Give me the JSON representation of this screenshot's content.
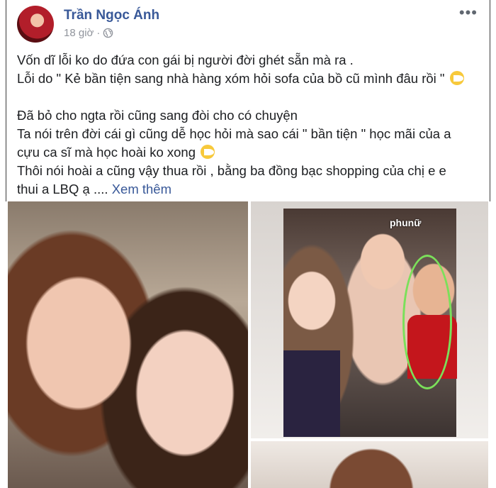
{
  "post": {
    "author": "Trần Ngọc Ánh",
    "time": "18 giờ",
    "privacy_icon": "globe-icon",
    "more_icon": "more-icon",
    "more_label": "•••",
    "lines": [
      "Vốn dĩ lỗi ko do đứa con gái bị người đời ghét sẵn mà ra .",
      "Lỗi do \" Kẻ bần tiện sang nhà hàng xóm hỏi sofa của bồ cũ mình đâu rồi \"",
      "Đã bỏ cho ngta rồi cũng sang đòi cho có chuyện",
      "Ta nói trên đời cái gì cũng dễ học hỏi mà sao cái \" bần tiện \" học mãi của a",
      "cựu ca sĩ mà học hoài ko xong",
      "Thôi nói hoài a cũng vậy thua rồi , bằng ba đồng bạc shopping của chị e e",
      "thui a LBQ ạ ...."
    ],
    "see_more": "Xem thêm",
    "emoji_icon": "laughing-emoji-icon"
  },
  "photos": {
    "watermark": "phunữ"
  },
  "colors": {
    "name_color": "#385898",
    "meta_color": "#90949c",
    "text_color": "#1c1e21",
    "circle_mark": "#7be05a"
  }
}
